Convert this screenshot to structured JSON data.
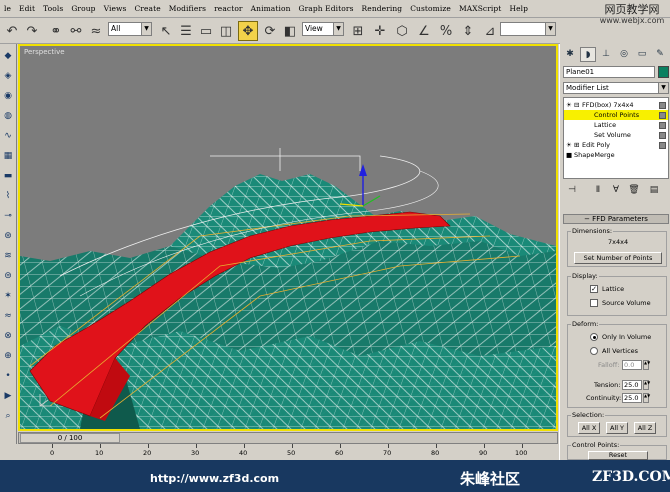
{
  "menu": [
    "le",
    "Edit",
    "Tools",
    "Group",
    "Views",
    "Create",
    "Modifiers",
    "reactor",
    "Animation",
    "Graph Editors",
    "Rendering",
    "Customize",
    "MAXScript",
    "Help"
  ],
  "watermark_top": {
    "line1": "网页教学网",
    "line2": "www.webjx.com"
  },
  "toolbar": {
    "selection_filter": "All",
    "reference_coord": "View",
    "icons": [
      "undo-icon",
      "redo-icon",
      "select-link-icon",
      "unlink-icon",
      "bind-spacewarp-icon",
      "select-icon",
      "select-by-name-icon",
      "rect-region-icon",
      "window-crossing-icon",
      "move-icon",
      "rotate-icon",
      "scale-icon",
      "pivot-icon",
      "manipulate-icon",
      "snap-icon",
      "angle-snap-icon",
      "percent-snap-icon",
      "spinner-snap-icon"
    ]
  },
  "viewport": {
    "label": "Perspective"
  },
  "time_slider": {
    "label": "0 / 100",
    "ticks": [
      "0",
      "10",
      "20",
      "30",
      "40",
      "50",
      "60",
      "70",
      "80",
      "90",
      "100"
    ]
  },
  "command_panel": {
    "object_name": "Plane01",
    "modifier_list_label": "Modifier List",
    "object_color": "#0a8060",
    "stack": [
      {
        "label": "FFD(box) 7x4x4",
        "selected": false
      },
      {
        "label": "Control Points",
        "selected": true
      },
      {
        "label": "Lattice",
        "selected": false
      },
      {
        "label": "Set Volume",
        "selected": false
      },
      {
        "label": "Edit Poly",
        "selected": false
      },
      {
        "label": "ShapeMerge",
        "selected": false
      }
    ],
    "rollout_title": "FFD Parameters",
    "dimensions": {
      "label": "Dimensions:",
      "value": "7x4x4",
      "button": "Set Number of Points"
    },
    "display": {
      "label": "Display:",
      "lattice": "Lattice",
      "lattice_checked": true,
      "source_volume": "Source Volume",
      "source_volume_checked": false
    },
    "deform": {
      "label": "Deform:",
      "only_in_volume": "Only In Volume",
      "all_vertices": "All Vertices",
      "falloff_label": "Falloff:",
      "falloff": "0.0",
      "tension_label": "Tension:",
      "tension": "25.0",
      "continuity_label": "Continuity:",
      "continuity": "25.0"
    },
    "selection": {
      "label": "Selection:",
      "buttons": [
        "All X",
        "All Y",
        "All Z"
      ]
    },
    "control_points": {
      "label": "Control Points:",
      "reset": "Reset"
    }
  },
  "status": {
    "url": "http://www.zf3d.com",
    "brand_cn": "朱峰社区",
    "brand_en": "ZF3D.COM"
  }
}
